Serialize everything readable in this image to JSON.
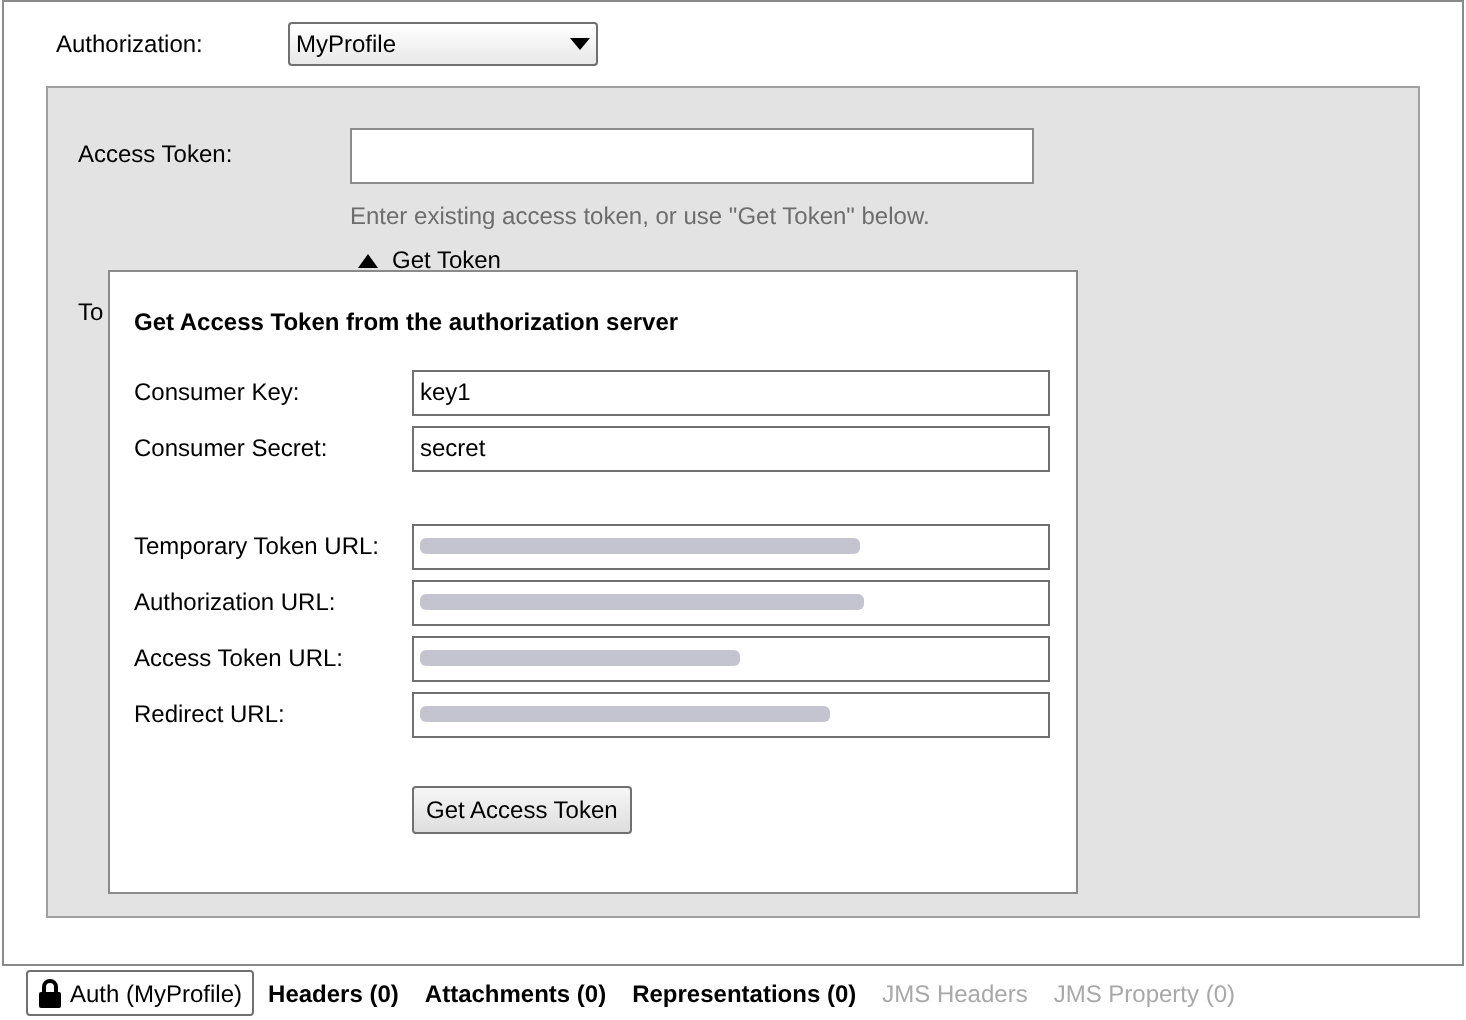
{
  "authorization": {
    "label": "Authorization:",
    "value": "MyProfile"
  },
  "access_token": {
    "label": "Access Token:",
    "hint": "Enter existing access token, or use \"Get Token\" below.",
    "toggle": "Get Token",
    "expanded": true
  },
  "next_label": "To",
  "popup": {
    "title": "Get Access Token from the authorization server",
    "fields": [
      {
        "label": "Consumer Key:",
        "kind": "text",
        "value": "key1"
      },
      {
        "label": "Consumer Secret:",
        "kind": "text",
        "value": "secret"
      },
      {
        "label": "Temporary Token URL:",
        "kind": "redacted"
      },
      {
        "label": "Authorization URL:",
        "kind": "redacted"
      },
      {
        "label": "Access Token URL:",
        "kind": "redacted"
      },
      {
        "label": "Redirect URL:",
        "kind": "redacted"
      }
    ],
    "button": "Get Access Token"
  },
  "tabs": [
    {
      "label": "Auth (MyProfile)",
      "selected": true,
      "disabled": false,
      "icon": true
    },
    {
      "label": "Headers (0)",
      "selected": false,
      "disabled": false,
      "icon": false
    },
    {
      "label": "Attachments (0)",
      "selected": false,
      "disabled": false,
      "icon": false
    },
    {
      "label": "Representations (0)",
      "selected": false,
      "disabled": false,
      "icon": false
    },
    {
      "label": "JMS Headers",
      "selected": false,
      "disabled": true,
      "icon": false
    },
    {
      "label": "JMS Property (0)",
      "selected": false,
      "disabled": true,
      "icon": false
    }
  ]
}
